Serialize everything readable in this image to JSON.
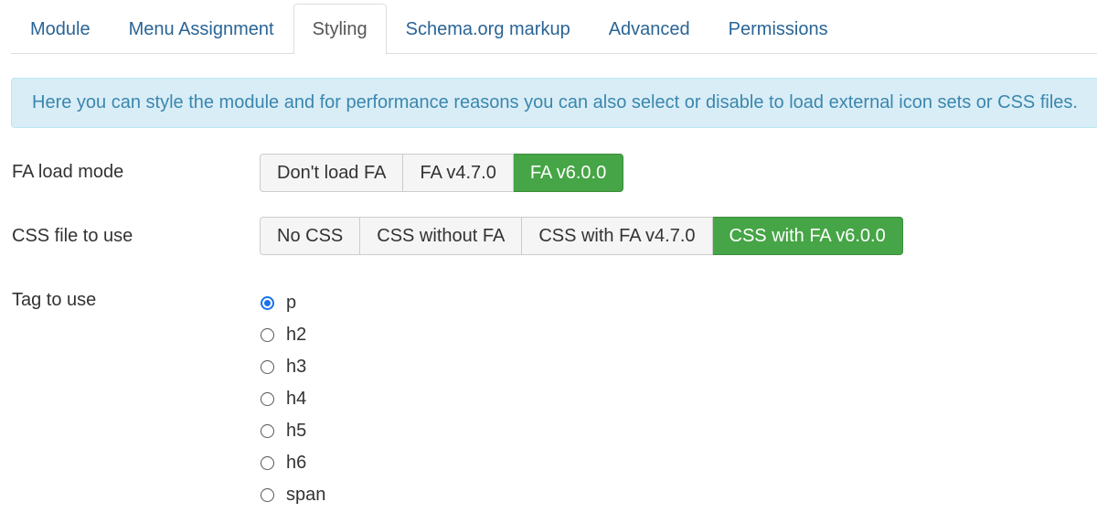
{
  "tabs": [
    {
      "label": "Module",
      "active": false
    },
    {
      "label": "Menu Assignment",
      "active": false
    },
    {
      "label": "Styling",
      "active": true
    },
    {
      "label": "Schema.org markup",
      "active": false
    },
    {
      "label": "Advanced",
      "active": false
    },
    {
      "label": "Permissions",
      "active": false
    }
  ],
  "info": {
    "text": "Here you can style the module and for performance reasons you can also select or disable to load external icon sets or CSS files."
  },
  "fa_load_mode": {
    "label": "FA load mode",
    "options": [
      "Don't load FA",
      "FA v4.7.0",
      "FA v6.0.0"
    ],
    "selected": "FA v6.0.0"
  },
  "css_file": {
    "label": "CSS file to use",
    "options": [
      "No CSS",
      "CSS without FA",
      "CSS with FA v4.7.0",
      "CSS with FA v6.0.0"
    ],
    "selected": "CSS with FA v6.0.0"
  },
  "tag_to_use": {
    "label": "Tag to use",
    "options": [
      "p",
      "h2",
      "h3",
      "h4",
      "h5",
      "h6",
      "span"
    ],
    "selected": "p"
  },
  "colors": {
    "accent_green": "#46a546",
    "link_blue": "#2a6496",
    "info_bg": "#d9edf7",
    "radio_blue": "#1a73e8"
  }
}
